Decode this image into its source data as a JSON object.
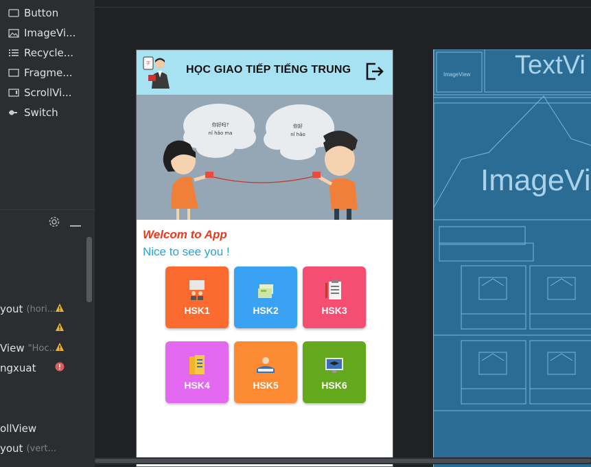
{
  "palette": {
    "items": [
      {
        "label": "Button",
        "icon": "button-icon"
      },
      {
        "label": "ImageVi...",
        "icon": "image-icon"
      },
      {
        "label": "Recycle...",
        "icon": "list-icon"
      },
      {
        "label": "Fragme...",
        "icon": "fragment-icon"
      },
      {
        "label": "ScrollVi...",
        "icon": "scroll-icon"
      },
      {
        "label": "Switch",
        "icon": "switch-icon"
      }
    ]
  },
  "tree": {
    "rows": [
      {
        "label": "yout",
        "muted": "(hori..."
      },
      {
        "label": "",
        "muted": ""
      },
      {
        "label": "View",
        "muted": "\"Hoc..."
      },
      {
        "label": "ngxuat",
        "muted": ""
      },
      {
        "label": "ollView",
        "muted": ""
      },
      {
        "label": "yout",
        "muted": "(vert..."
      }
    ]
  },
  "app": {
    "title": "HỌC GIAO TIẾP TIẾNG TRUNG",
    "bubble_left": "你好吗?\nnǐ hǎo ma",
    "bubble_right": "你好\nnǐ hǎo",
    "welcome": "Welcom to App",
    "nice": "Nice to see you !",
    "tiles": [
      {
        "label": "HSK1",
        "color": "#fb6a2e"
      },
      {
        "label": "HSK2",
        "color": "#3aa2f2"
      },
      {
        "label": "HSK3",
        "color": "#f54e73"
      },
      {
        "label": "HSK4",
        "color": "#e36af0"
      },
      {
        "label": "HSK5",
        "color": "#fc8a33"
      },
      {
        "label": "HSK6",
        "color": "#63a81d"
      }
    ]
  },
  "blueprint": {
    "textview": "TextVi",
    "imageview": "ImageVi",
    "imageview_small": "ImageView"
  }
}
